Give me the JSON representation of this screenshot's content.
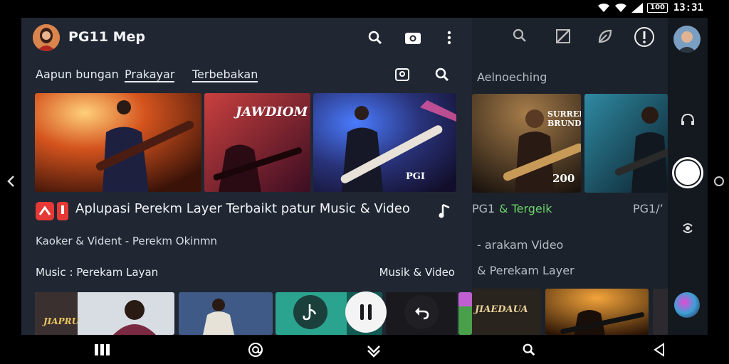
{
  "status": {
    "battery": "100",
    "time": "13:31"
  },
  "app": {
    "title": "PG11 Mep"
  },
  "tabs": [
    {
      "label": "Aapun bungan"
    },
    {
      "label": "Prakayar"
    },
    {
      "label": "Terbebakan"
    }
  ],
  "thumbnails": {
    "t2_caption": "JAWDIOM",
    "t3_caption": "PGI",
    "s1_badge": "200",
    "s1_caption": "SURRER BRUNDA",
    "b1_caption": "JIAPRU",
    "s3_caption": "JIAEDAUA"
  },
  "video": {
    "title": "Aplupasi Perekm Layer Terbaikt patur Music & Video",
    "meta": "Kaoker & Vident - Perekm Okinmn",
    "category_left": "Music : Perekam Layan",
    "category_right": "Musik & Video"
  },
  "second_panel": {
    "section_label": "Aelnoeching",
    "pg_prefix": "PG1",
    "pg_green": "& Tergeik",
    "pg_right": "PG1/’",
    "line1": "- arakam Video",
    "line2": "& Perekam Layer"
  },
  "colors": {
    "panel": "#202733",
    "accent_red": "#e53935",
    "accent_green": "#6ad16a"
  }
}
